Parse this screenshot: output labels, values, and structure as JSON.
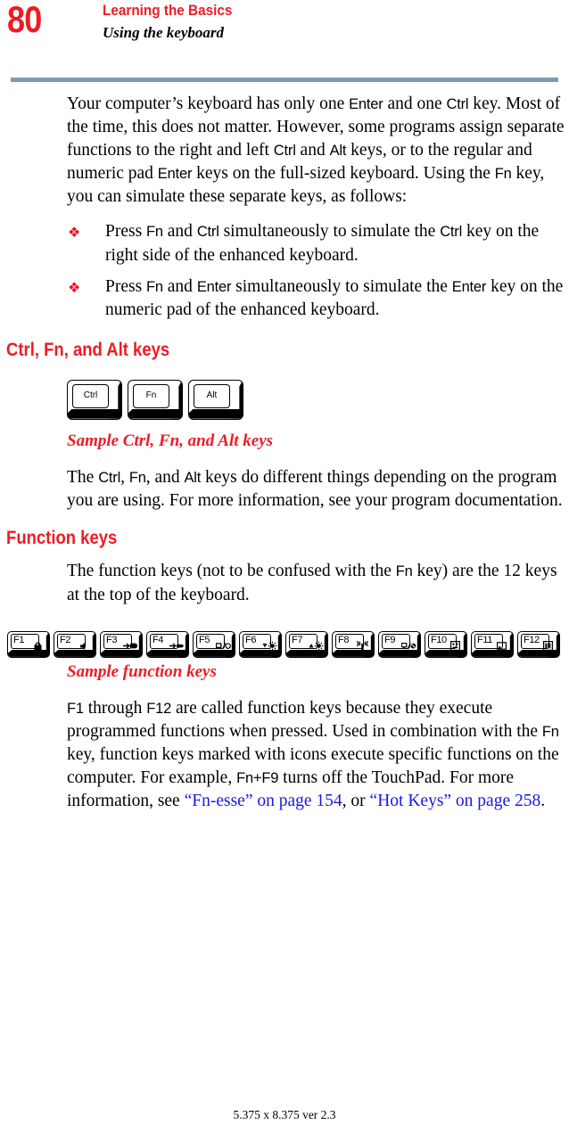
{
  "header": {
    "page_number": "80",
    "title": "Learning the Basics",
    "subtitle": "Using the keyboard",
    "rule_color": "#7f99b4",
    "accent_color": "#ed1c24"
  },
  "intro": {
    "p1_a": "Your computer’s keyboard has only one ",
    "p1_k1": "Enter",
    "p1_b": " and one ",
    "p1_k2": "Ctrl",
    "p1_c": " key. Most of the time, this does not matter. However, some programs assign separate functions to the right and left ",
    "p1_k3": "Ctrl",
    "p1_d": " and ",
    "p1_k4": "Alt",
    "p1_e": " keys, or to the regular and numeric pad ",
    "p1_k5": "Enter",
    "p1_f": " keys on the full-sized keyboard. Using the ",
    "p1_k6": "Fn",
    "p1_g": " key, you can simulate these separate keys, as follows:"
  },
  "bullets": [
    {
      "marker": "❖",
      "a": "Press ",
      "k1": "Fn",
      "b": " and ",
      "k2": "Ctrl",
      "c": " simultaneously to simulate the ",
      "k3": "Ctrl",
      "d": " key on the right side of the enhanced keyboard."
    },
    {
      "marker": "❖",
      "a": "Press ",
      "k1": "Fn",
      "b": " and ",
      "k2": "Enter",
      "c": " simultaneously to simulate the ",
      "k3": "Enter",
      "d": " key on the numeric pad of the enhanced keyboard."
    }
  ],
  "section_ctrl": {
    "heading": "Ctrl, Fn, and Alt keys",
    "keys": [
      {
        "label": "Ctrl"
      },
      {
        "label": "Fn"
      },
      {
        "label": "Alt"
      }
    ],
    "caption": "Sample Ctrl, Fn, and Alt keys",
    "body_a": "The ",
    "body_k1": "Ctrl",
    "body_b": ", ",
    "body_k2": "Fn",
    "body_c": ", and ",
    "body_k3": "Alt",
    "body_d": " keys do different things depending on the program you are using. For more information, see your program documentation."
  },
  "section_function": {
    "heading": "Function keys",
    "intro_a": "The function keys (not to be confused with the ",
    "intro_k1": "Fn",
    "intro_b": " key) are the 12 keys at the top of the keyboard.",
    "fkeys": [
      {
        "label": "F1",
        "icon": "lock-icon"
      },
      {
        "label": "F2",
        "icon": "speaker-mute-icon"
      },
      {
        "label": "F3",
        "icon": "sleep-icon"
      },
      {
        "label": "F4",
        "icon": "hibernate-icon"
      },
      {
        "label": "F5",
        "icon": "display-toggle-icon"
      },
      {
        "label": "F6",
        "icon": "brightness-down-icon"
      },
      {
        "label": "F7",
        "icon": "brightness-up-icon"
      },
      {
        "label": "F8",
        "icon": "wireless-icon"
      },
      {
        "label": "F9",
        "icon": "touchpad-toggle-icon"
      },
      {
        "label": "F10",
        "icon": "keypad-icon"
      },
      {
        "label": "F11",
        "icon": "numlock-icon"
      },
      {
        "label": "F12",
        "icon": "scroll-lock-icon"
      }
    ],
    "caption": "Sample function keys",
    "body_k1": "F1",
    "body_a": " through ",
    "body_k2": "F12",
    "body_b": " are called function keys because they execute programmed functions when pressed. Used in combination with the ",
    "body_k3": "Fn",
    "body_c": " key, function keys marked with icons execute specific functions on the computer. For example, ",
    "body_k4": "Fn+F9",
    "body_d": " turns off the TouchPad. For more information, see ",
    "link1": "“Fn-esse” on page 154",
    "body_e": ", or ",
    "link2": "“Hot Keys” on page 258",
    "body_f": ".",
    "link_color": "#1a18e0"
  },
  "footer": {
    "text": "5.375 x 8.375 ver 2.3"
  }
}
